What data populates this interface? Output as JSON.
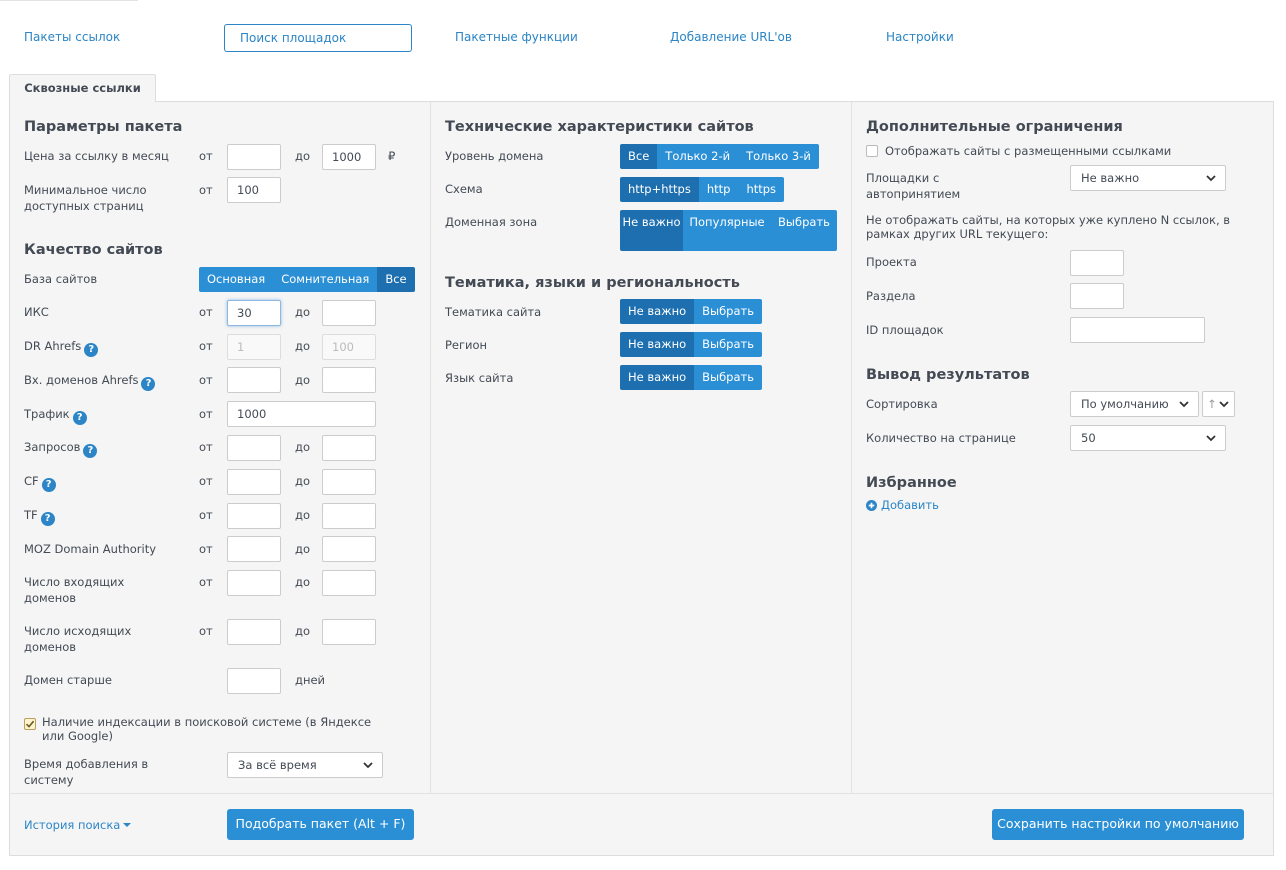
{
  "nav": {
    "packages": "Пакеты ссылок",
    "search": "Поиск площадок",
    "batch": "Пакетные функции",
    "add_url": "Добавление URL'ов",
    "settings": "Настройки"
  },
  "tab": "Сквозные ссылки",
  "col1": {
    "params_title": "Параметры пакета",
    "price_label": "Цена за ссылку в месяц",
    "price_from": "",
    "price_to": "1000",
    "currency": "₽",
    "min_pages_label": "Минимальное число доступных страниц",
    "min_pages_from": "100",
    "quality_title": "Качество сайтов",
    "base_label": "База сайтов",
    "base_options": [
      "Основная",
      "Сомнительная",
      "Все"
    ],
    "iks_label": "ИКС",
    "iks_from": "30",
    "dr_label": "DR Ahrefs",
    "dr_from_ph": "1",
    "dr_to_ph": "100",
    "ref_label": "Вх. доменов Ahrefs",
    "traffic_label": "Трафик",
    "traffic_from": "1000",
    "queries_label": "Запросов",
    "cf_label": "CF",
    "tf_label": "TF",
    "moz_label": "MOZ Domain Authority",
    "in_domains_label": "Число входящих доменов",
    "out_domains_label": "Число исходящих доменов",
    "domain_age_label": "Домен старше",
    "days": "дней",
    "index_label": "Наличие индексации в поисковой системе (в Яндексе или Google)",
    "added_label": "Время добавления в систему",
    "added_value": "За всё время",
    "from": "от",
    "to": "до"
  },
  "col2": {
    "tech_title": "Технические характеристики сайтов",
    "level_label": "Уровень домена",
    "level_options": [
      "Все",
      "Только 2-й",
      "Только 3-й"
    ],
    "scheme_label": "Схема",
    "scheme_options": [
      "http+https",
      "http",
      "https"
    ],
    "zone_label": "Доменная зона",
    "zone_options": [
      "Не важно",
      "Популярные",
      "Выбрать"
    ],
    "theme_title": "Тематика, языки и региональность",
    "topic_label": "Тематика сайта",
    "region_label": "Регион",
    "lang_label": "Язык сайта",
    "any": "Не важно",
    "choose": "Выбрать"
  },
  "col3": {
    "extra_title": "Дополнительные ограничения",
    "show_placed_label": "Отображать сайты с размещенными ссылками",
    "auto_label": "Площадки с автопринятием",
    "auto_value": "Не важно",
    "note": "Не отображать сайты, на которых уже куплено N ссылок, в рамках других URL текущего:",
    "project_label": "Проекта",
    "section_label": "Раздела",
    "ids_label": "ID площадок",
    "output_title": "Вывод результатов",
    "sort_label": "Сортировка",
    "sort_value": "По умолчанию",
    "sort_dir_value": "↑",
    "per_page_label": "Количество на странице",
    "per_page_value": "50",
    "fav_title": "Избранное",
    "fav_add": "Добавить"
  },
  "footer": {
    "history": "История поиска",
    "find": "Подобрать пакет (Alt + F)",
    "save": "Сохранить настройки по умолчанию"
  },
  "colors": {
    "accent": "#2b8fd6",
    "accent_active": "#1d6fb0",
    "link": "#2b85c6",
    "panel_bg": "#f5f5f5"
  }
}
